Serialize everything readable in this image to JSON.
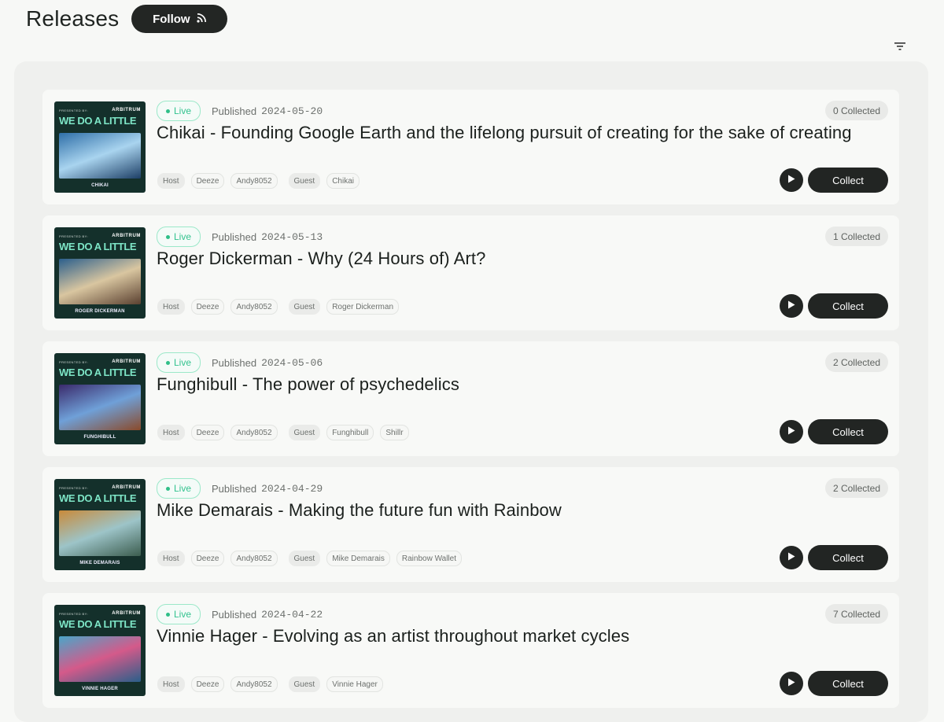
{
  "header": {
    "title": "Releases",
    "follow_label": "Follow"
  },
  "icons": {
    "follow": "rss-icon",
    "filter": "filter-icon",
    "play": "play-icon"
  },
  "colors": {
    "accent_dark": "#222523",
    "live_green": "#33c38f",
    "cover_bg": "#14302b",
    "cover_text": "#7ee6c7"
  },
  "releases": [
    {
      "status": "Live",
      "published_label": "Published",
      "date": "2024-05-20",
      "collected": "0 Collected",
      "title": "Chikai - Founding Google Earth and the lifelong pursuit of creating for the sake of creating",
      "host_label": "Host",
      "hosts": [
        "Deeze",
        "Andy8052"
      ],
      "guest_label": "Guest",
      "guests": [
        "Chikai"
      ],
      "cover": {
        "presented": "PRESENTED BY:",
        "brand": "ARBITRUM",
        "series": "WE DO A LITTLE",
        "name": "CHIKAI",
        "art_colors": [
          "#2f6fa8",
          "#a9d4ef",
          "#1d3f66"
        ]
      },
      "play_label": "▶",
      "collect_label": "Collect"
    },
    {
      "status": "Live",
      "published_label": "Published",
      "date": "2024-05-13",
      "collected": "1 Collected",
      "title": "Roger Dickerman - Why (24 Hours of) Art?",
      "host_label": "Host",
      "hosts": [
        "Deeze",
        "Andy8052"
      ],
      "guest_label": "Guest",
      "guests": [
        "Roger Dickerman"
      ],
      "cover": {
        "presented": "PRESENTED BY:",
        "brand": "ARBITRUM",
        "series": "WE DO A LITTLE",
        "name": "ROGER DICKERMAN",
        "art_colors": [
          "#2b5f8c",
          "#d9c6a0",
          "#5a4030"
        ]
      },
      "play_label": "▶",
      "collect_label": "Collect"
    },
    {
      "status": "Live",
      "published_label": "Published",
      "date": "2024-05-06",
      "collected": "2 Collected",
      "title": "Funghibull - The power of psychedelics",
      "host_label": "Host",
      "hosts": [
        "Deeze",
        "Andy8052"
      ],
      "guest_label": "Guest",
      "guests": [
        "Funghibull",
        "Shillr"
      ],
      "cover": {
        "presented": "PRESENTED BY:",
        "brand": "ARBITRUM",
        "series": "WE DO A LITTLE",
        "name": "FUNGHIBULL",
        "art_colors": [
          "#3a2a6b",
          "#6fa0d8",
          "#8a4a2a"
        ]
      },
      "play_label": "▶",
      "collect_label": "Collect"
    },
    {
      "status": "Live",
      "published_label": "Published",
      "date": "2024-04-29",
      "collected": "2 Collected",
      "title": "Mike Demarais - Making the future fun with Rainbow",
      "host_label": "Host",
      "hosts": [
        "Deeze",
        "Andy8052"
      ],
      "guest_label": "Guest",
      "guests": [
        "Mike Demarais",
        "Rainbow Wallet"
      ],
      "cover": {
        "presented": "PRESENTED BY:",
        "brand": "ARBITRUM",
        "series": "WE DO A LITTLE",
        "name": "MIKE DEMARAIS",
        "art_colors": [
          "#c98a3a",
          "#9dc4c8",
          "#3c5d4f"
        ]
      },
      "play_label": "▶",
      "collect_label": "Collect"
    },
    {
      "status": "Live",
      "published_label": "Published",
      "date": "2024-04-22",
      "collected": "7 Collected",
      "title": "Vinnie Hager - Evolving as an artist throughout market cycles",
      "host_label": "Host",
      "hosts": [
        "Deeze",
        "Andy8052"
      ],
      "guest_label": "Guest",
      "guests": [
        "Vinnie Hager"
      ],
      "cover": {
        "presented": "PRESENTED BY:",
        "brand": "ARBITRUM",
        "series": "WE DO A LITTLE",
        "name": "VINNIE HAGER",
        "art_colors": [
          "#4aa6c9",
          "#d45a8a",
          "#2a5f8a"
        ]
      },
      "play_label": "▶",
      "collect_label": "Collect"
    }
  ]
}
